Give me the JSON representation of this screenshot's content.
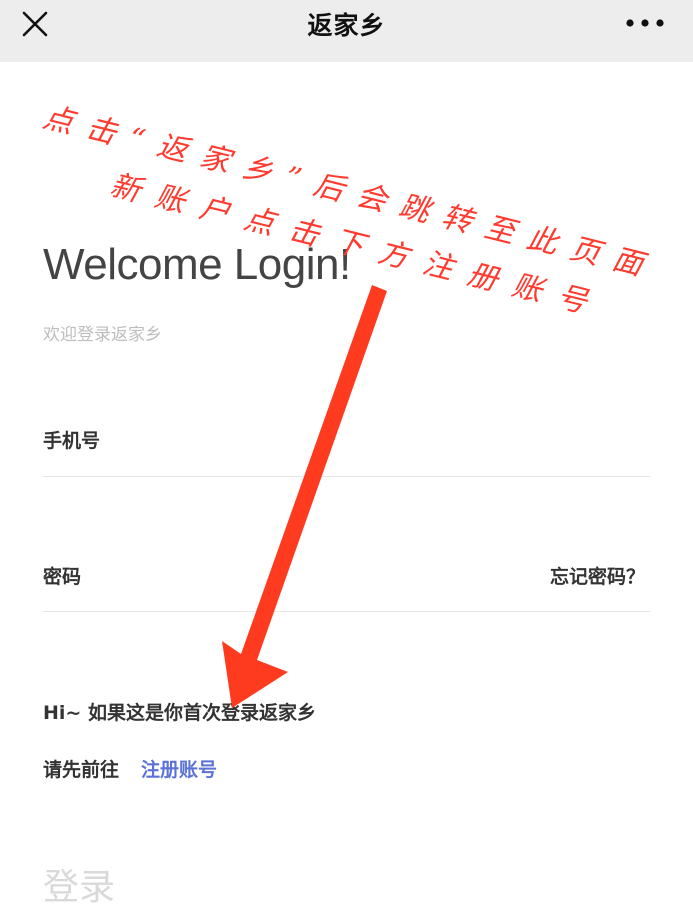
{
  "header": {
    "title": "返家乡"
  },
  "login": {
    "welcome": "Welcome Login!",
    "subtitle": "欢迎登录返家乡",
    "phone_label": "手机号",
    "password_label": "密码",
    "forgot_password": "忘记密码？",
    "hint_line1": "Hi~ 如果这是你首次登录返家乡",
    "hint_line2": "请先前往",
    "register_link": "注册账号",
    "login_button": "登录"
  },
  "annotation": {
    "line1": "点击“返家乡”后会跳转至此页面",
    "line2": "新账户点击下方注册账号",
    "color": "#ff3b30"
  },
  "colors": {
    "link": "#5b72d6",
    "disabled": "#d9d9d9",
    "topbar": "#ededed"
  },
  "icons": {
    "close": "close-icon",
    "more": "more-icon"
  }
}
